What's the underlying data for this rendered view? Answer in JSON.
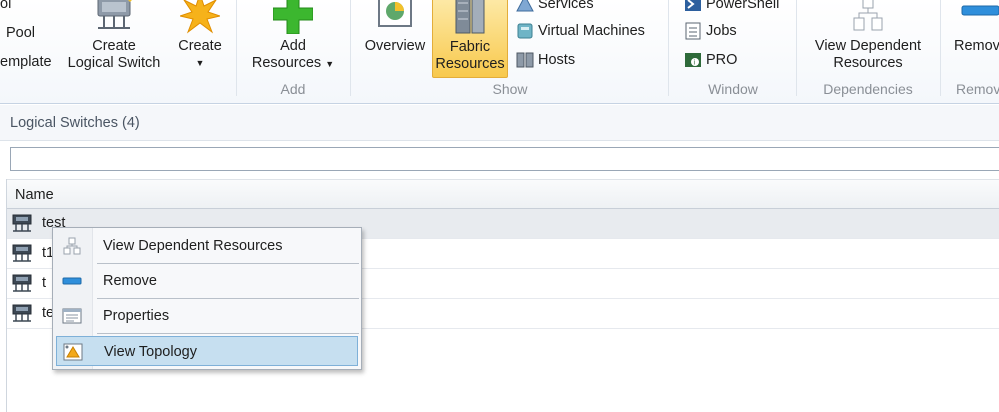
{
  "ribbon": {
    "partial_top": "ol",
    "pool_label": "Pool",
    "template_label": "emplate",
    "create_logical_switch": [
      "Create",
      "Logical Switch"
    ],
    "create": [
      "Create"
    ],
    "add_resources": [
      "Add",
      "Resources"
    ],
    "overview": "Overview",
    "fabric_resources": [
      "Fabric",
      "Resources"
    ],
    "services": "Services",
    "virtual_machines": "Virtual Machines",
    "hosts": "Hosts",
    "powershell": "PowerShell",
    "jobs": "Jobs",
    "pro": "PRO",
    "view_dependent_resources": [
      "View Dependent",
      "Resources"
    ],
    "remove": "Remov",
    "groups": {
      "add": "Add",
      "show": "Show",
      "window": "Window",
      "dependencies": "Dependencies",
      "remove": "Remov"
    }
  },
  "panel": {
    "title": "Logical Switches (4)",
    "search_value": "",
    "column_name": "Name",
    "rows": [
      "test",
      "t1",
      "t",
      "te"
    ]
  },
  "context_menu": {
    "items": [
      "View Dependent Resources",
      "Remove",
      "Properties",
      "View Topology"
    ],
    "highlighted": "View Topology"
  },
  "colors": {
    "accent_highlight": "#c6dff0",
    "fabric_button_bg": "#fbd777",
    "add_icon_green": "#3cb72f"
  }
}
